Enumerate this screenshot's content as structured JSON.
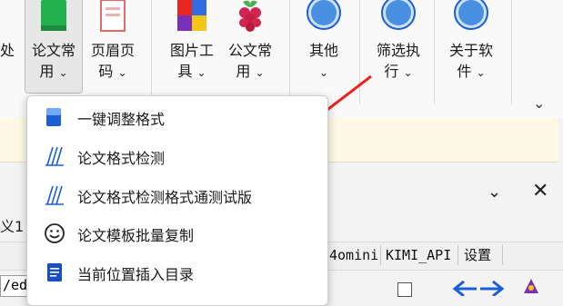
{
  "ribbon": {
    "partial_left_label": [
      "处",
      ""
    ],
    "buttons": [
      {
        "name": "lunwen-changyong",
        "line1": "论文常",
        "line2": "用",
        "chevron": "⌄",
        "icon": "green-book-icon"
      },
      {
        "name": "yemei-yema",
        "line1": "页眉页",
        "line2": "码",
        "chevron": "⌄",
        "icon": "page-header-icon"
      },
      {
        "name": "tupian-gongju",
        "line1": "图片工",
        "line2": "具",
        "chevron": "⌄",
        "icon": "image-tool-icon"
      },
      {
        "name": "gongwen-changyong",
        "line1": "公文常",
        "line2": "用",
        "chevron": "⌄",
        "icon": "raspberry-icon"
      },
      {
        "name": "qita",
        "line1": "其他",
        "line2": "",
        "chevron": "⌄",
        "icon": "circle-icon"
      },
      {
        "name": "shaixuan-zhixing",
        "line1": "筛选执",
        "line2": "行",
        "chevron": "⌄",
        "icon": "circle-icon"
      },
      {
        "name": "guanyu-ruanjian",
        "line1": "关于软",
        "line2": "件",
        "chevron": "⌄",
        "icon": "circle-icon"
      }
    ],
    "collapse_glyph": "⌄"
  },
  "pane": {
    "clip_left": "义1",
    "chevron": "⌄",
    "close": "✕"
  },
  "tabs": {
    "partial": "4omini",
    "items": [
      "KIMI_API",
      "设置"
    ]
  },
  "address": {
    "value": "/ed"
  },
  "dropdown": {
    "items": [
      {
        "label": "一键调整格式",
        "icon": "document-blue-icon"
      },
      {
        "label": "论文格式检测",
        "icon": "paper-lines-icon"
      },
      {
        "label": "论文格式检测格式通测试版",
        "icon": "paper-lines-icon"
      },
      {
        "label": "论文模板批量复制",
        "icon": "smiley-icon"
      },
      {
        "label": "当前位置插入目录",
        "icon": "toc-document-icon"
      }
    ]
  },
  "colors": {
    "accent_blue": "#1a5fd6",
    "arrow_red": "#e8261f",
    "notice_bg": "#fdf8e4"
  }
}
